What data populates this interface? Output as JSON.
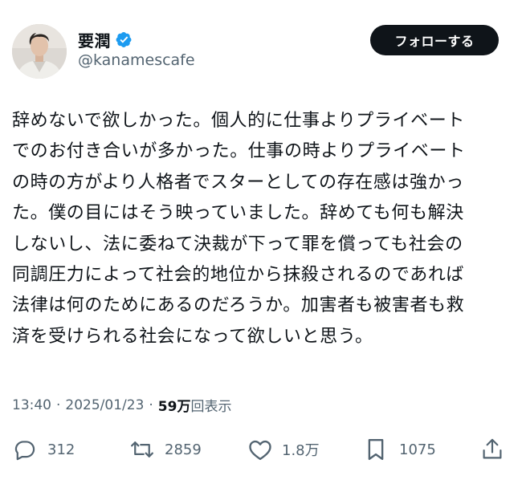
{
  "author": {
    "display_name": "要潤",
    "handle": "@kanamescafe",
    "verified": true,
    "avatar": "profile-photo"
  },
  "follow_button": {
    "label": "フォローする"
  },
  "tweet": {
    "lines": [
      "辞めないで欲しかった。個人的に仕事よりプライベート",
      "でのお付き合いが多かった。仕事の時よりプライベート",
      "の時の方がより人格者でスターとしての存在感は強かっ",
      "た。僕の目にはそう映っていました。辞めても何も解決",
      "しないし、法に委ねて決裁が下って罪を償っても社会の",
      "同調圧力によって社会的地位から抹殺されるのであれば",
      "法律は何のためにあるのだろうか。加害者も被害者も救",
      "済を受けられる社会になって欲しいと思う。"
    ]
  },
  "meta": {
    "time": "13:40",
    "separator": "·",
    "date": "2025/01/23",
    "views_count": "59万",
    "views_label": "回表示"
  },
  "actions": {
    "replies": {
      "icon": "reply-icon",
      "count": "312"
    },
    "reposts": {
      "icon": "repost-icon",
      "count": "2859"
    },
    "likes": {
      "icon": "like-icon",
      "count": "1.8万"
    },
    "bookmarks": {
      "icon": "bookmark-icon",
      "count": "1075"
    },
    "share": {
      "icon": "share-icon"
    }
  },
  "colors": {
    "text_primary": "#0f1419",
    "text_secondary": "#536471",
    "verified_blue": "#1d9bf0",
    "button_bg": "#0f1419",
    "button_text": "#ffffff"
  }
}
